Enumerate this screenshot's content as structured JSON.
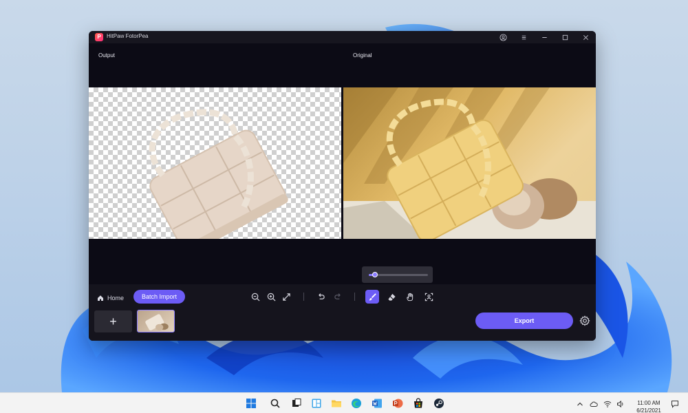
{
  "window": {
    "title": "HitPaw FotorPea",
    "logo_letter": "P"
  },
  "panes": {
    "output_label": "Output",
    "original_label": "Original"
  },
  "toolbar": {
    "home_label": "Home",
    "batch_import_label": "Batch Import",
    "add_label": "+",
    "export_label": "Export",
    "brush_size": 0.1,
    "icons": [
      "zoom-out-icon",
      "zoom-in-icon",
      "fit-screen-icon",
      "undo-icon",
      "redo-icon",
      "brush-icon",
      "eraser-icon",
      "hand-icon",
      "select-subject-icon"
    ]
  },
  "taskbar": {
    "time": "11:00 AM",
    "date": "6/21/2021",
    "apps": [
      "start",
      "search",
      "task-view",
      "widgets",
      "file-explorer",
      "edge",
      "word",
      "powerpoint",
      "store",
      "steam"
    ]
  },
  "colors": {
    "accent": "#6c5cf5",
    "window_bg": "#0c0b15",
    "toolbar_bg": "#15141d"
  }
}
